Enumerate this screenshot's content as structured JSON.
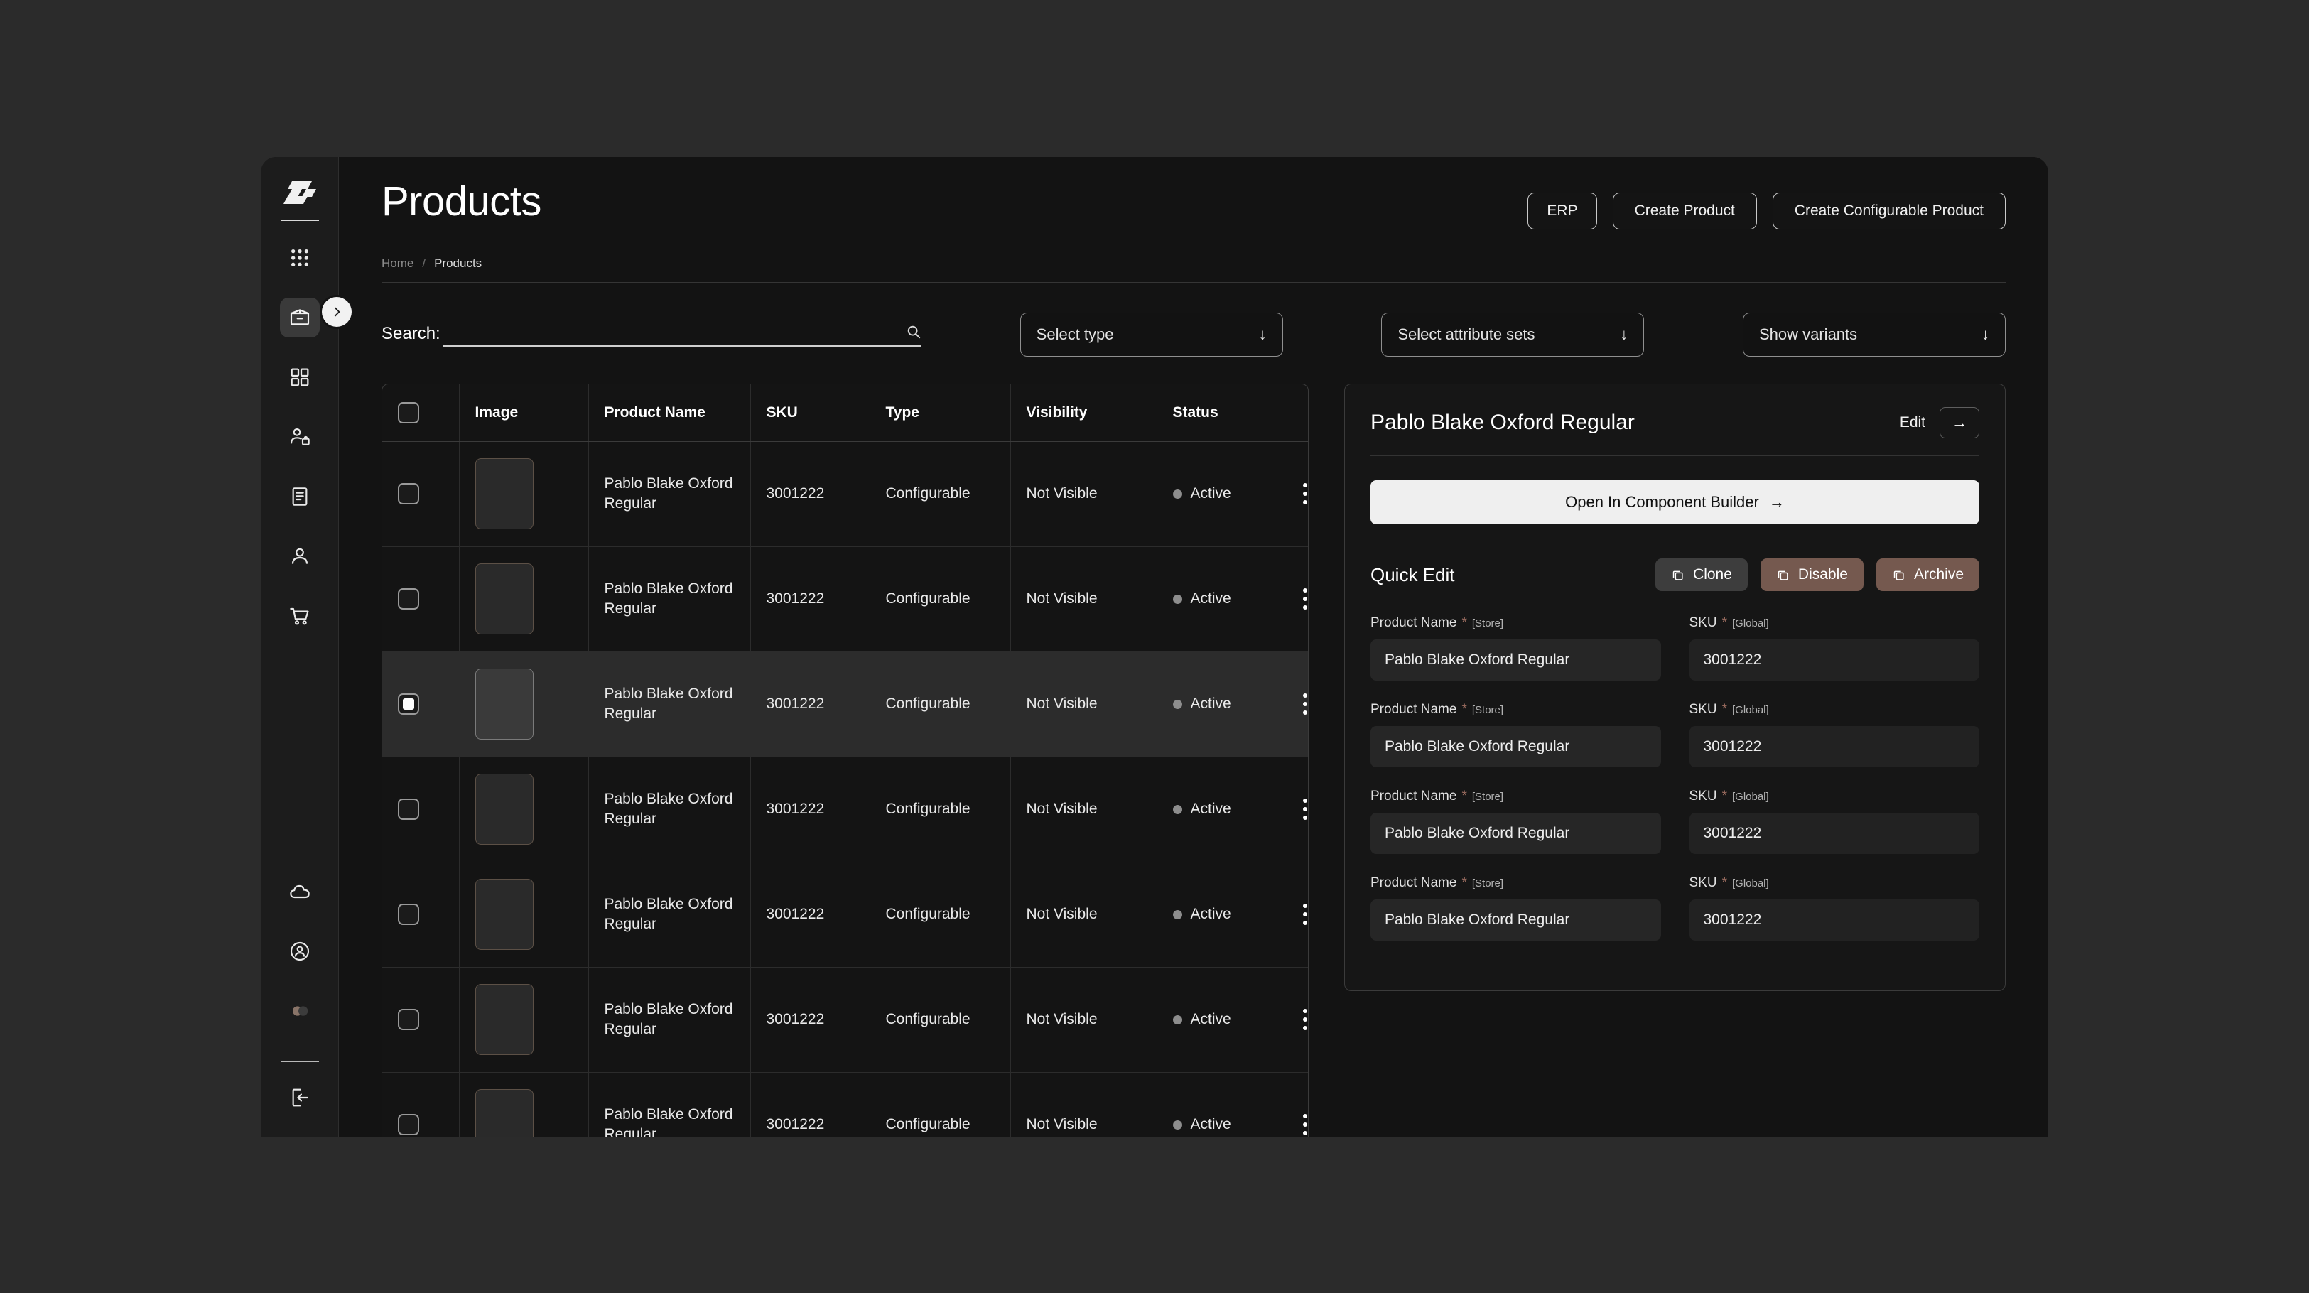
{
  "app": {
    "logo": "stackline-logo-icon"
  },
  "sidebar": {
    "items": [
      {
        "name": "apps-grid-dots",
        "label": "Apps",
        "active": false
      },
      {
        "name": "package-box",
        "label": "Products",
        "active": true
      },
      {
        "name": "grid-squares",
        "label": "Catalog",
        "active": false
      },
      {
        "name": "customer-bag",
        "label": "Customers",
        "active": false
      },
      {
        "name": "document-lines",
        "label": "Pages",
        "active": false
      },
      {
        "name": "user-person",
        "label": "Users",
        "active": false
      },
      {
        "name": "shopping-cart",
        "label": "Orders",
        "active": false
      }
    ],
    "bottom_items": [
      {
        "name": "cloud",
        "label": "Cloud"
      },
      {
        "name": "user-circle",
        "label": "Account"
      },
      {
        "name": "avatar-group",
        "label": "Team"
      }
    ],
    "logout": {
      "name": "logout",
      "label": "Log out"
    },
    "toggle": {
      "label": "Expand sidebar",
      "glyph": "chevron-right"
    }
  },
  "header": {
    "title": "Products",
    "buttons": [
      {
        "label": "ERP"
      },
      {
        "label": "Create Product"
      },
      {
        "label": "Create Configurable Product"
      }
    ]
  },
  "breadcrumb": {
    "home": "Home",
    "separator": "/",
    "current": "Products"
  },
  "filters": {
    "search_label": "Search:",
    "search_value": "",
    "search_placeholder": "",
    "selects": [
      {
        "label": "Select type",
        "arrow": "↓"
      },
      {
        "label": "Select attribute sets",
        "arrow": "↓"
      },
      {
        "label": "Show variants",
        "arrow": "↓"
      }
    ]
  },
  "table": {
    "columns": [
      "Image",
      "Product Name",
      "SKU",
      "Type",
      "Visibility",
      "Status"
    ],
    "rows": [
      {
        "name": "Pablo Blake Oxford Regular",
        "sku": "3001222",
        "type": "Configurable",
        "visibility": "Not Visible",
        "status": "Active",
        "selected": false
      },
      {
        "name": "Pablo Blake Oxford Regular",
        "sku": "3001222",
        "type": "Configurable",
        "visibility": "Not Visible",
        "status": "Active",
        "selected": false
      },
      {
        "name": "Pablo Blake Oxford Regular",
        "sku": "3001222",
        "type": "Configurable",
        "visibility": "Not Visible",
        "status": "Active",
        "selected": true
      },
      {
        "name": "Pablo Blake Oxford Regular",
        "sku": "3001222",
        "type": "Configurable",
        "visibility": "Not Visible",
        "status": "Active",
        "selected": false
      },
      {
        "name": "Pablo Blake Oxford Regular",
        "sku": "3001222",
        "type": "Configurable",
        "visibility": "Not Visible",
        "status": "Active",
        "selected": false
      },
      {
        "name": "Pablo Blake Oxford Regular",
        "sku": "3001222",
        "type": "Configurable",
        "visibility": "Not Visible",
        "status": "Active",
        "selected": false
      },
      {
        "name": "Pablo Blake Oxford Regular",
        "sku": "3001222",
        "type": "Configurable",
        "visibility": "Not Visible",
        "status": "Active",
        "selected": false
      }
    ]
  },
  "detail": {
    "title": "Pablo Blake Oxford Regular",
    "edit_label": "Edit",
    "arrow_glyph": "→",
    "open_builder_label": "Open In Component Builder",
    "quick_edit_title": "Quick Edit",
    "actions": [
      {
        "label": "Clone",
        "style": "clone",
        "color": "#3d3d3d"
      },
      {
        "label": "Disable",
        "style": "disable",
        "color": "#75594f"
      },
      {
        "label": "Archive",
        "style": "archive",
        "color": "#75594f"
      }
    ],
    "fields": [
      {
        "label": "Product Name",
        "required": "*",
        "scope": "[Store]",
        "value": "Pablo Blake Oxford Regular",
        "kind": "store"
      },
      {
        "label": "SKU",
        "required": "*",
        "scope": "[Global]",
        "value": "3001222",
        "kind": "global"
      },
      {
        "label": "Product Name",
        "required": "*",
        "scope": "[Store]",
        "value": "Pablo Blake Oxford Regular",
        "kind": "store"
      },
      {
        "label": "SKU",
        "required": "*",
        "scope": "[Global]",
        "value": "3001222",
        "kind": "global"
      },
      {
        "label": "Product Name",
        "required": "*",
        "scope": "[Store]",
        "value": "Pablo Blake Oxford Regular",
        "kind": "store"
      },
      {
        "label": "SKU",
        "required": "*",
        "scope": "[Global]",
        "value": "3001222",
        "kind": "global"
      },
      {
        "label": "Product Name",
        "required": "*",
        "scope": "[Store]",
        "value": "Pablo Blake Oxford Regular",
        "kind": "store"
      },
      {
        "label": "SKU",
        "required": "*",
        "scope": "[Global]",
        "value": "3001222",
        "kind": "global"
      }
    ]
  },
  "colors": {
    "page_bg": "#2b2b2b",
    "window_bg": "#111111",
    "sidebar_bg": "#1c1c1c",
    "accent_brown": "#75594f",
    "selected_row": "#2c2c2c",
    "primary_btn": "#efefef"
  }
}
